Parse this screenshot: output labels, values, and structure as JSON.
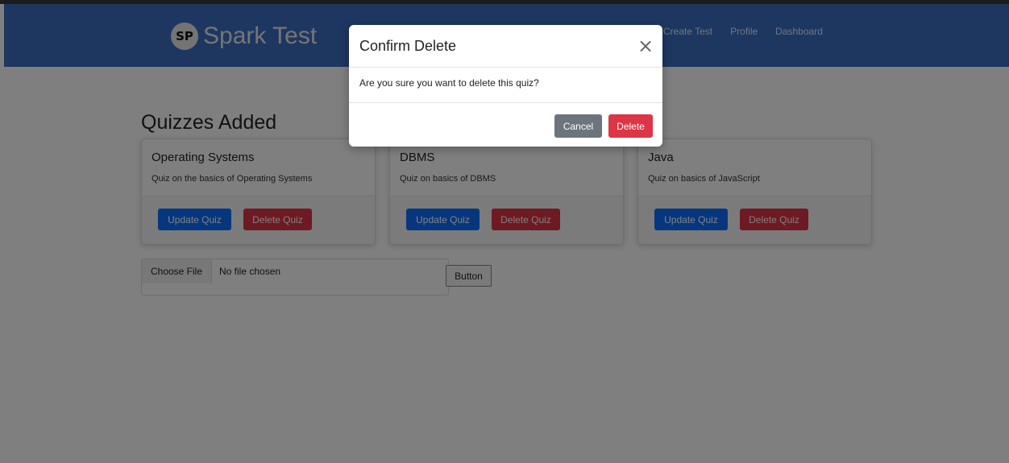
{
  "brand": {
    "logo_text": "SP",
    "name": "Spark Test"
  },
  "nav": {
    "links": [
      "Create Test",
      "Profile",
      "Dashboard"
    ]
  },
  "page": {
    "title": "Quizzes Added"
  },
  "quizzes": [
    {
      "title": "Operating Systems",
      "description": "Quiz on the basics of Operating Systems",
      "update_label": "Update Quiz",
      "delete_label": "Delete Quiz"
    },
    {
      "title": "DBMS",
      "description": "Quiz on basics of DBMS",
      "update_label": "Update Quiz",
      "delete_label": "Delete Quiz"
    },
    {
      "title": "Java",
      "description": "Quiz on basics of JavaScript",
      "update_label": "Update Quiz",
      "delete_label": "Delete Quiz"
    }
  ],
  "file_input": {
    "choose_label": "Choose File",
    "status": "No file chosen"
  },
  "upload_button_label": "Button",
  "modal": {
    "title": "Confirm Delete",
    "close_icon": "close-icon",
    "message": "Are you sure you want to delete this quiz?",
    "cancel_label": "Cancel",
    "delete_label": "Delete"
  },
  "colors": {
    "navbar": "#3b6fc2",
    "primary": "#0d6efd",
    "danger": "#dc3545",
    "secondary": "#6c757d"
  }
}
